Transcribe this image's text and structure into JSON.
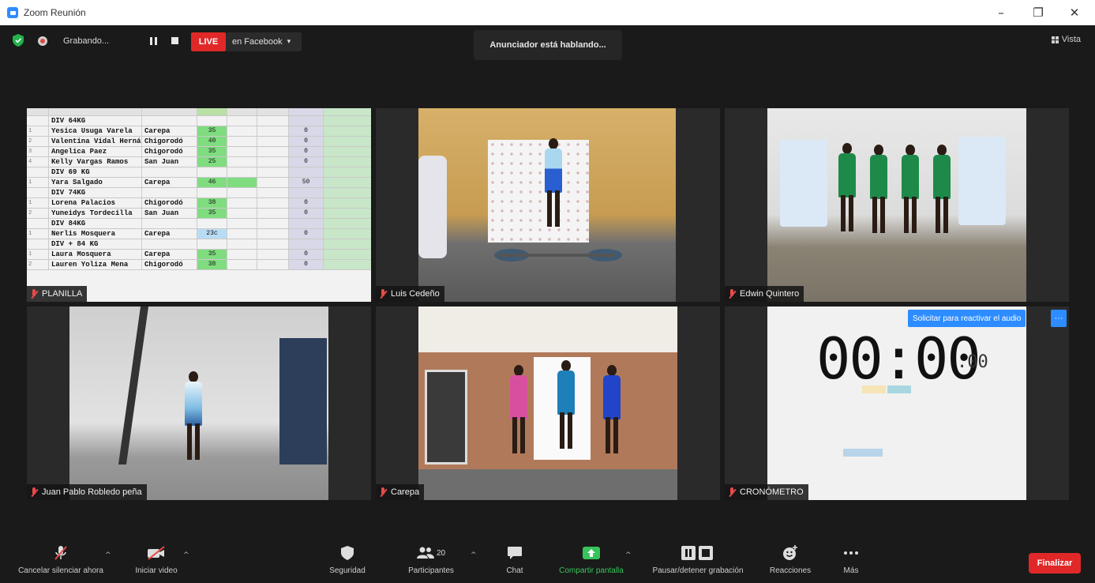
{
  "window": {
    "title": "Zoom Reunión",
    "minimize": "–",
    "restore": "❐",
    "close": "✕"
  },
  "topbar": {
    "recording_text": "Grabando...",
    "live_label": "LIVE",
    "live_platform": "en Facebook",
    "dropdown_caret": "▾",
    "speaker_notice": "Anunciador está hablando...",
    "view_label": "Vista"
  },
  "tiles": [
    {
      "name": "PLANILLA"
    },
    {
      "name": "Luis Cedeño"
    },
    {
      "name": "Edwin Quintero"
    },
    {
      "name": "Juan Pablo Robledo peña"
    },
    {
      "name": "Carepa"
    },
    {
      "name": "CRONÓMETRO"
    }
  ],
  "spreadsheet": {
    "rows": [
      {
        "n": "",
        "name": "DIV 64KG",
        "club": "",
        "v1": "",
        "v2": ""
      },
      {
        "n": "1",
        "name": "Yesica Usuga Varela",
        "club": "Carepa",
        "v1": "35",
        "v2": "0"
      },
      {
        "n": "2",
        "name": "Valentina Vidal Hernán",
        "club": "Chigorodó",
        "v1": "40",
        "v2": "0"
      },
      {
        "n": "3",
        "name": "Angelica Paez",
        "club": "Chigorodó",
        "v1": "35",
        "v2": "0"
      },
      {
        "n": "4",
        "name": "Kelly Vargas Ramos",
        "club": "San Juan",
        "v1": "25",
        "v2": "0"
      },
      {
        "n": "",
        "name": "DIV 69 KG",
        "club": "",
        "v1": "",
        "v2": ""
      },
      {
        "n": "1",
        "name": "Yara Salgado",
        "club": "Carepa",
        "v1": "46",
        "v2": "50"
      },
      {
        "n": "",
        "name": "DIV 74KG",
        "club": "",
        "v1": "",
        "v2": ""
      },
      {
        "n": "1",
        "name": "Lorena Palacios",
        "club": "Chigorodó",
        "v1": "38",
        "v2": "0"
      },
      {
        "n": "2",
        "name": "Yuneidys Tordecilla",
        "club": "San Juan",
        "v1": "35",
        "v2": "0"
      },
      {
        "n": "",
        "name": "DIV 84KG",
        "club": "",
        "v1": "",
        "v2": ""
      },
      {
        "n": "1",
        "name": "Nerlis Mosquera",
        "club": "Carepa",
        "v1": "23c",
        "v2": "0"
      },
      {
        "n": "",
        "name": "DIV + 84 KG",
        "club": "",
        "v1": "",
        "v2": ""
      },
      {
        "n": "1",
        "name": "Laura Mosquera",
        "club": "Carepa",
        "v1": "35",
        "v2": "0"
      },
      {
        "n": "2",
        "name": "Lauren Yoliza Mena",
        "club": "Chigorodó",
        "v1": "38",
        "v2": "0"
      }
    ]
  },
  "stopwatch": {
    "time": "00:00",
    "hundredths": ".00"
  },
  "unmute_request": {
    "label": "Solicitar para reactivar el audio",
    "more": "···"
  },
  "toolbar": {
    "mute": "Cancelar silenciar ahora",
    "video": "Iniciar video",
    "security": "Seguridad",
    "participants": "Participantes",
    "participants_count": "20",
    "chat": "Chat",
    "share": "Compartir pantalla",
    "record": "Pausar/detener grabación",
    "reactions": "Reacciones",
    "more": "Más",
    "end": "Finalizar"
  },
  "colors": {
    "zoom_blue": "#2D8CFF",
    "live_red": "#E02828",
    "share_green": "#37C45A",
    "background": "#1A1A1A"
  }
}
